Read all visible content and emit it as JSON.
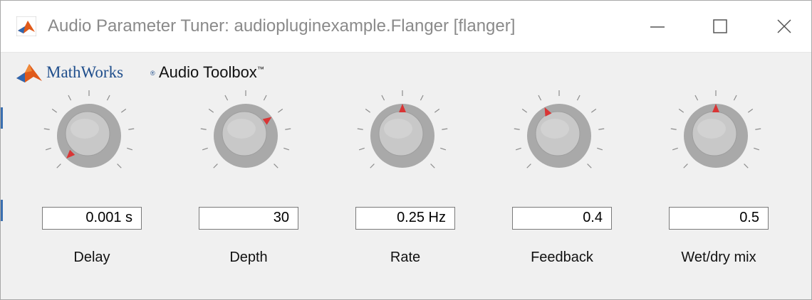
{
  "window": {
    "title": "Audio Parameter Tuner: audiopluginexample.Flanger [flanger]",
    "icon": "matlab-icon",
    "controls": [
      "minimize",
      "maximize",
      "close"
    ]
  },
  "brand": {
    "company": "MathWorks",
    "product": "Audio Toolbox",
    "trademark": "™",
    "logo": "matlab-membrane-logo"
  },
  "colors": {
    "knob_face": "#c8c8c8",
    "knob_ring": "#a9a9a9",
    "indicator": "#d93535",
    "brand_blue": "#1f4e8c"
  },
  "parameters": [
    {
      "label": "Delay",
      "value": "0.001 s",
      "knob_position": 0.0
    },
    {
      "label": "Depth",
      "value": "30",
      "knob_position": 0.7
    },
    {
      "label": "Rate",
      "value": "0.25 Hz",
      "knob_position": 0.5
    },
    {
      "label": "Feedback",
      "value": "0.4",
      "knob_position": 0.4
    },
    {
      "label": "Wet/dry mix",
      "value": "0.5",
      "knob_position": 0.5
    }
  ]
}
